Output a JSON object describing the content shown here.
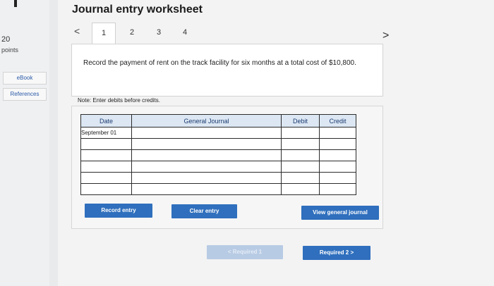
{
  "sidebar": {
    "points_value": "20",
    "points_label": "points",
    "ebook_label": "eBook",
    "references_label": "References"
  },
  "header": {
    "title": "Journal entry worksheet",
    "prev_glyph": "<",
    "next_glyph": ">"
  },
  "tabs": [
    {
      "label": "1",
      "active": true
    },
    {
      "label": "2",
      "active": false
    },
    {
      "label": "3",
      "active": false
    },
    {
      "label": "4",
      "active": false
    }
  ],
  "prompt": {
    "text": "Record the payment of rent on the track facility for six months at a total cost of $10,800."
  },
  "note": "Note: Enter debits before credits.",
  "journal": {
    "headers": {
      "date": "Date",
      "general_journal": "General Journal",
      "debit": "Debit",
      "credit": "Credit"
    },
    "rows": [
      {
        "date": "September 01",
        "account": "",
        "debit": "",
        "credit": ""
      },
      {
        "date": "",
        "account": "",
        "debit": "",
        "credit": ""
      },
      {
        "date": "",
        "account": "",
        "debit": "",
        "credit": ""
      },
      {
        "date": "",
        "account": "",
        "debit": "",
        "credit": ""
      },
      {
        "date": "",
        "account": "",
        "debit": "",
        "credit": ""
      },
      {
        "date": "",
        "account": "",
        "debit": "",
        "credit": ""
      }
    ]
  },
  "buttons": {
    "record_entry": "Record entry",
    "clear_entry": "Clear entry",
    "view_general_journal": "View general journal",
    "required_prev": "< Required 1",
    "required_next": "Required 2 >"
  },
  "colors": {
    "accent": "#2f6fbd",
    "header_fill": "#dce7f3",
    "disabled_fill": "#b8cbe4"
  }
}
